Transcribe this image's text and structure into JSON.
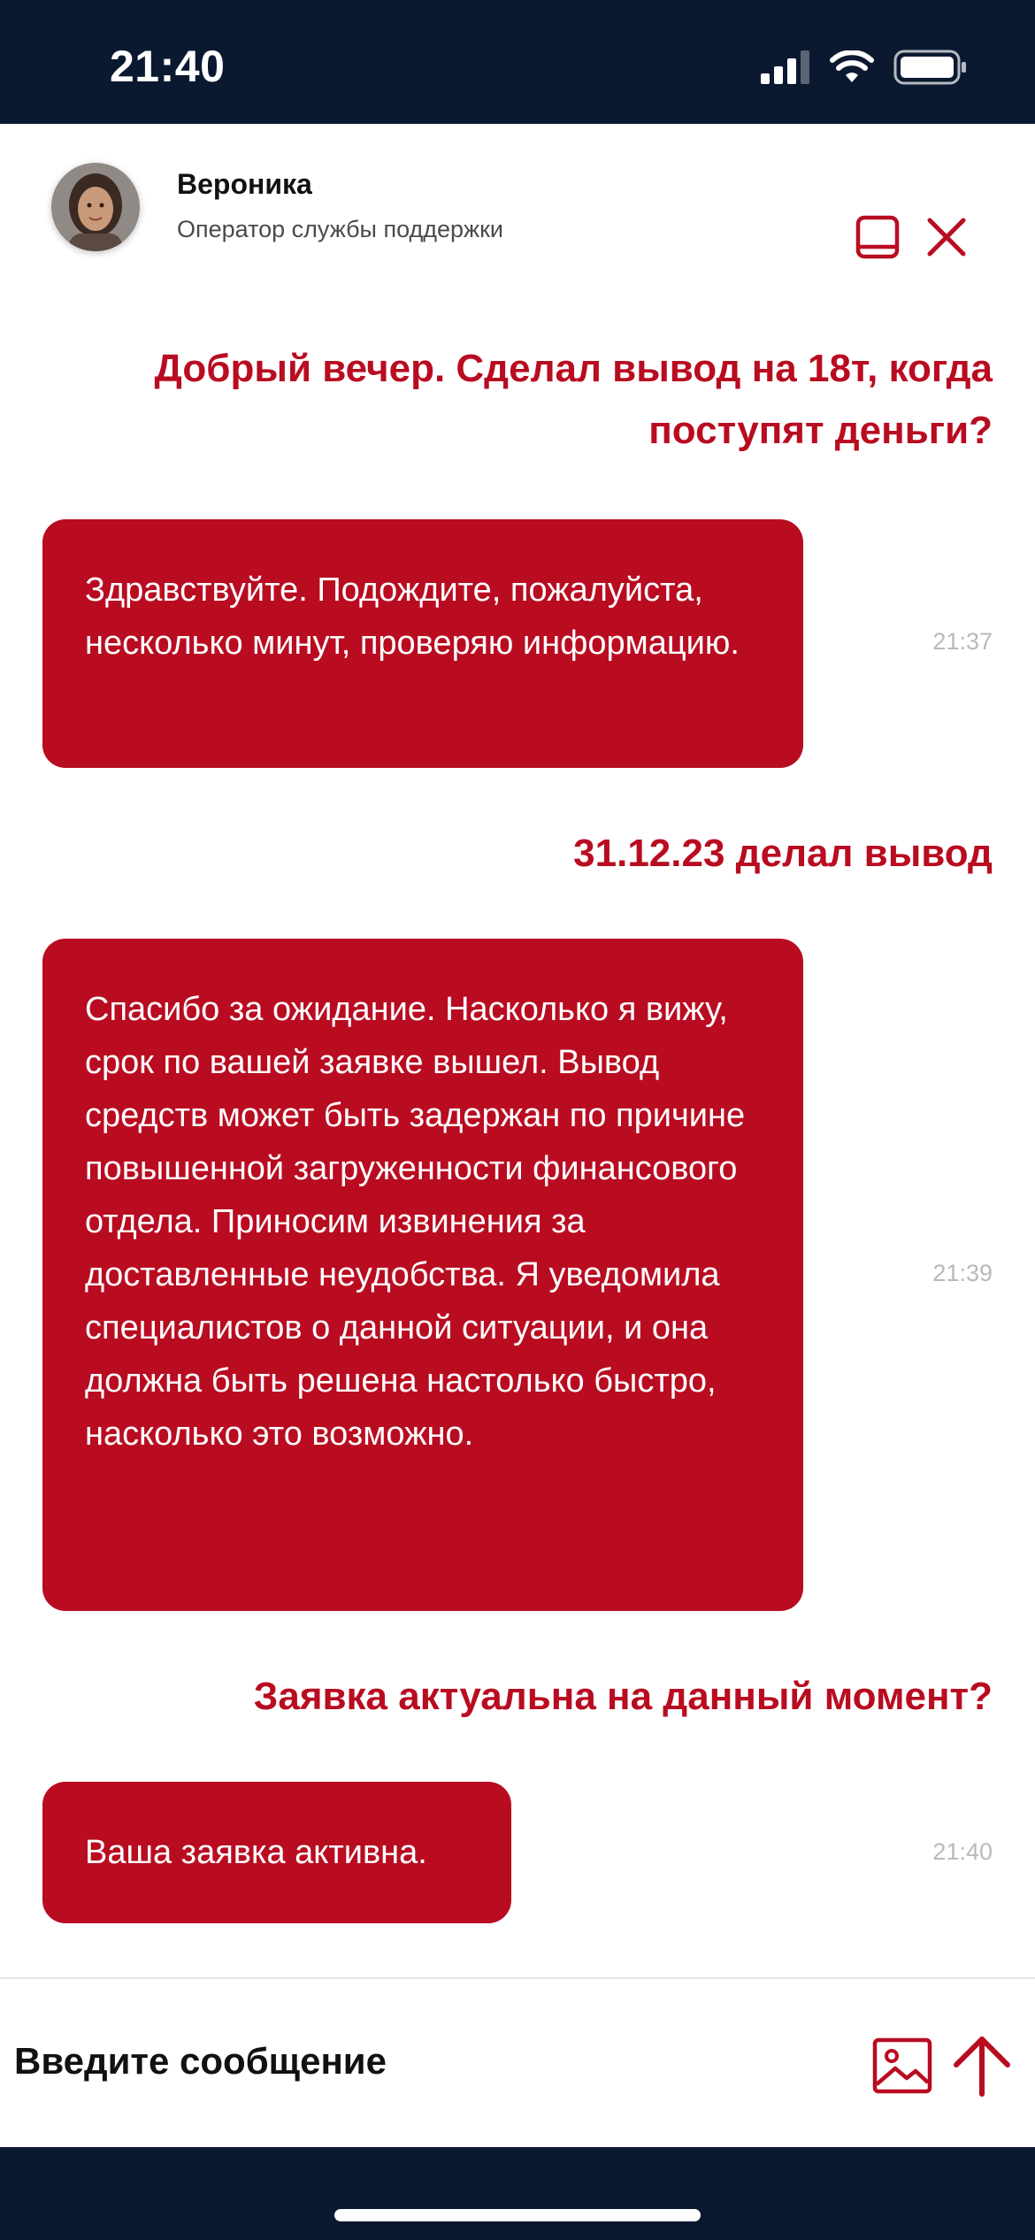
{
  "status_bar": {
    "time": "21:40"
  },
  "header": {
    "operator_name": "Вероника",
    "operator_role": "Оператор службы поддержки"
  },
  "messages": [
    {
      "from": "user",
      "text": "Добрый вечер. Сделал вывод на 18т, когда поступят деньги?"
    },
    {
      "from": "operator",
      "text": "Здравствуйте. Подождите, пожалуйста, несколько минут, проверяю информацию.",
      "time": "21:37"
    },
    {
      "from": "user",
      "text": "31.12.23 делал вывод"
    },
    {
      "from": "operator",
      "text": "Спасибо за ожидание. Насколько я вижу, срок по вашей заявке вышел. Вывод средств может быть задержан по причине повышенной загруженности финансового отдела. Приносим извинения за доставленные неудобства. Я уведомила специалистов о данной ситуации, и она должна быть решена настолько быстро, насколько это возможно.",
      "time": "21:39"
    },
    {
      "from": "user",
      "text": "Заявка актуальна на данный момент?"
    },
    {
      "from": "operator",
      "text": "Ваша заявка активна.",
      "time": "21:40"
    }
  ],
  "composer": {
    "placeholder": "Введите сообщение"
  },
  "colors": {
    "accent": "#b90c21",
    "bar": "#0b1930",
    "timestamp": "#b9b9b9"
  },
  "icons": {
    "minimize": "minimize-icon",
    "close": "close-icon",
    "attach_image": "image-icon",
    "send": "arrow-up-icon"
  }
}
